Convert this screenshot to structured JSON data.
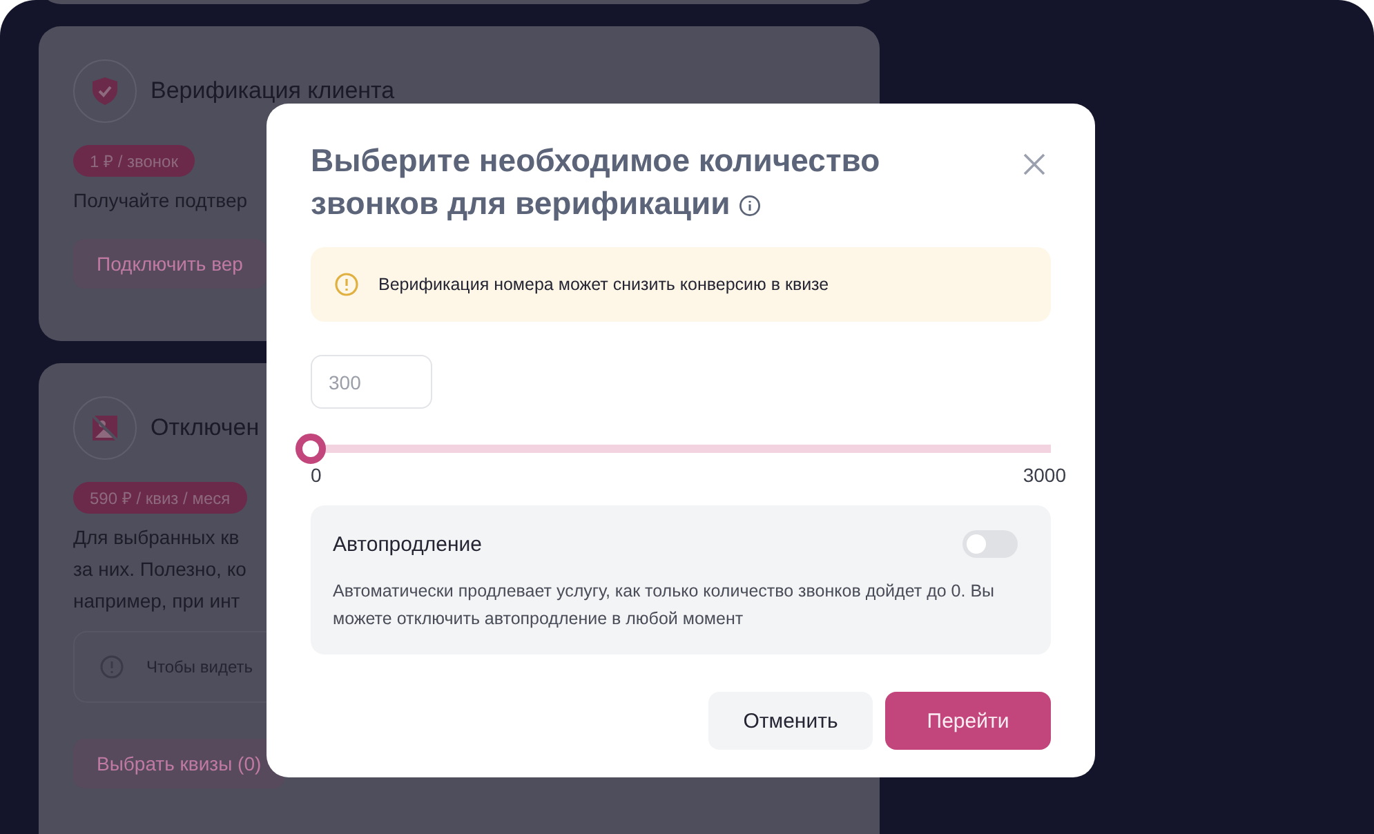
{
  "cards": [
    {
      "kind": "top"
    },
    {
      "kind": "verify",
      "title": "Верификация клиента",
      "badge": "1 ₽ / звонок",
      "lines": [
        "Получайте подтвер"
      ],
      "button": "Подключить вер"
    },
    {
      "kind": "disable",
      "title": "Отключен",
      "badge": "590 ₽ / квиз / меся",
      "lines": [
        "Для выбранных кв",
        "за них. Полезно, ко",
        "например, при инт"
      ],
      "notice": "Чтобы видеть",
      "button": "Выбрать квизы (0)"
    }
  ],
  "modal": {
    "title": "Выберите необходимое количество звонков для верификации",
    "warning": "Верификация номера может снизить конверсию в квизе",
    "amount": {
      "placeholder": "300"
    },
    "slider": {
      "level": 0,
      "min": "0",
      "max": "3000"
    },
    "autorenew": {
      "label": "Автопродление",
      "on": false,
      "description": "Автоматически продлевает услугу, как только количество звонков дойдет до 0. Вы можете отключить автопродление в любой момент"
    },
    "buttons": [
      {
        "kind": "secondary",
        "label": "Отменить"
      },
      {
        "kind": "primary",
        "label": "Перейти"
      }
    ]
  }
}
